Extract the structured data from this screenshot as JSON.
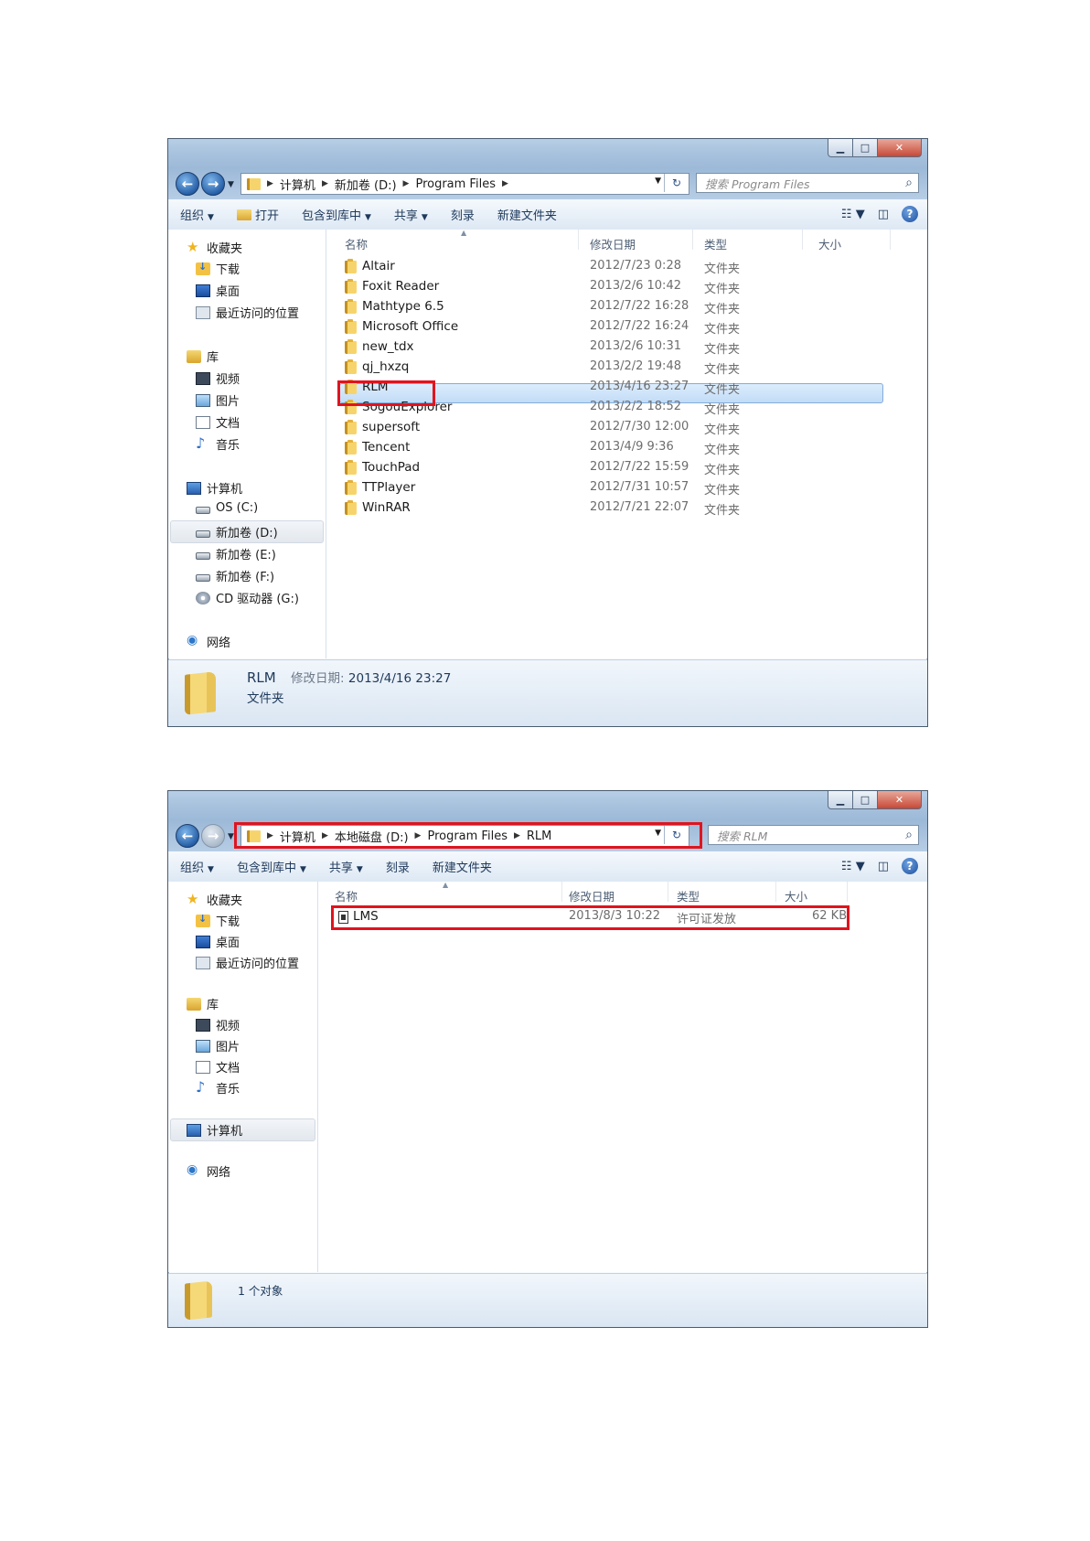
{
  "window1": {
    "breadcrumb": [
      "计算机",
      "新加卷 (D:)",
      "Program Files"
    ],
    "search_placeholder": "搜索 Program Files",
    "toolbar": {
      "organize": "组织",
      "open": "打开",
      "include_library": "包含到库中",
      "share": "共享",
      "burn": "刻录",
      "new_folder": "新建文件夹"
    },
    "nav": {
      "favorites": "收藏夹",
      "downloads": "下载",
      "desktop": "桌面",
      "recent": "最近访问的位置",
      "libraries": "库",
      "videos": "视频",
      "pictures": "图片",
      "documents": "文档",
      "music": "音乐",
      "computer": "计算机",
      "drive_c": "OS (C:)",
      "drive_d": "新加卷 (D:)",
      "drive_e": "新加卷 (E:)",
      "drive_f": "新加卷 (F:)",
      "drive_g": "CD 驱动器 (G:)",
      "network": "网络"
    },
    "columns": {
      "name": "名称",
      "date": "修改日期",
      "type": "类型",
      "size": "大小"
    },
    "rows": [
      {
        "name": "Altair",
        "date": "2012/7/23 0:28",
        "type": "文件夹"
      },
      {
        "name": "Foxit Reader",
        "date": "2013/2/6 10:42",
        "type": "文件夹"
      },
      {
        "name": "Mathtype 6.5",
        "date": "2012/7/22 16:28",
        "type": "文件夹"
      },
      {
        "name": "Microsoft Office",
        "date": "2012/7/22 16:24",
        "type": "文件夹"
      },
      {
        "name": "new_tdx",
        "date": "2013/2/6 10:31",
        "type": "文件夹"
      },
      {
        "name": "qj_hxzq",
        "date": "2013/2/2 19:48",
        "type": "文件夹"
      },
      {
        "name": "RLM",
        "date": "2013/4/16 23:27",
        "type": "文件夹"
      },
      {
        "name": "SogouExplorer",
        "date": "2013/2/2 18:52",
        "type": "文件夹"
      },
      {
        "name": "supersoft",
        "date": "2012/7/30 12:00",
        "type": "文件夹"
      },
      {
        "name": "Tencent",
        "date": "2013/4/9 9:36",
        "type": "文件夹"
      },
      {
        "name": "TouchPad",
        "date": "2012/7/22 15:59",
        "type": "文件夹"
      },
      {
        "name": "TTPlayer",
        "date": "2012/7/31 10:57",
        "type": "文件夹"
      },
      {
        "name": "WinRAR",
        "date": "2012/7/21 22:07",
        "type": "文件夹"
      }
    ],
    "status": {
      "name": "RLM",
      "date_label": "修改日期:",
      "date_value": "2013/4/16 23:27",
      "type": "文件夹"
    }
  },
  "window2": {
    "breadcrumb": [
      "计算机",
      "本地磁盘 (D:)",
      "Program Files",
      "RLM"
    ],
    "search_placeholder": "搜索 RLM",
    "toolbar": {
      "organize": "组织",
      "include_library": "包含到库中",
      "share": "共享",
      "burn": "刻录",
      "new_folder": "新建文件夹"
    },
    "nav": {
      "favorites": "收藏夹",
      "downloads": "下载",
      "desktop": "桌面",
      "recent": "最近访问的位置",
      "libraries": "库",
      "videos": "视频",
      "pictures": "图片",
      "documents": "文档",
      "music": "音乐",
      "computer": "计算机",
      "network": "网络"
    },
    "columns": {
      "name": "名称",
      "date": "修改日期",
      "type": "类型",
      "size": "大小"
    },
    "rows": [
      {
        "name": "LMS",
        "date": "2013/8/3 10:22",
        "type": "许可证发放",
        "size": "62 KB"
      }
    ],
    "status": {
      "count": "1 个对象"
    }
  },
  "colors": {
    "highlight_box": "#e0141e",
    "selection": "#c2dcf7",
    "titlebar": "#a9c3de"
  },
  "icons": {
    "back": "back-arrow-icon",
    "forward": "forward-arrow-icon",
    "search": "search-icon",
    "refresh": "refresh-icon",
    "help": "help-icon",
    "folder": "folder-icon",
    "license_file": "license-file-icon"
  }
}
